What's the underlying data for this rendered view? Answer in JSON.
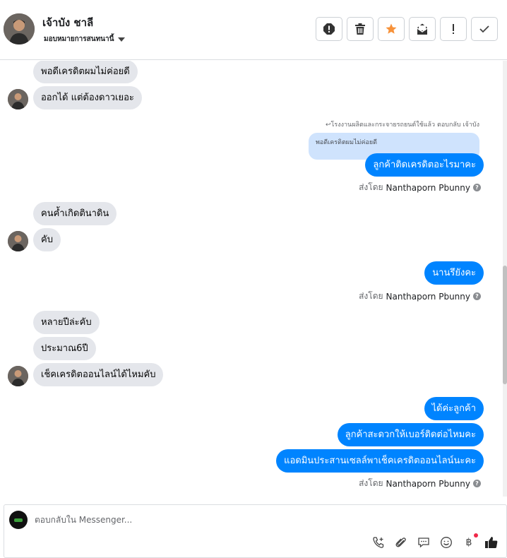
{
  "header": {
    "name": "เจ้าบัง ชาลี",
    "assign_label": "มอบหมายการสนทนานี้"
  },
  "thread": {
    "m1": "พอดีเครดิตผมไม่ค่อยดี",
    "m2": "ออกได้ แต่ต้องดาวเยอะ",
    "reply_meta": "↩โรงงานผลิตและกระจายรถยนต์ใช้แล้ว ตอบกลับ เจ้าบัง",
    "quote_text": "พอดีเครดิตผมไม่ค่อยดี",
    "m3": "ลูกค้าติดเครดิตอะไรมาคะ",
    "sent_prefix": "ส่งโดย",
    "sent_by": "Nanthaporn Pbunny",
    "m4": "คนค้ำเกิดตินาดิน",
    "m5": "คับ",
    "m6": "นานรึยังคะ",
    "m7": "หลายปีล่ะคับ",
    "m8": "ประมาณ6ปี",
    "m9": "เช็คเครดิตออนไลน์ได้ไหมคับ",
    "m10": "ได้ค่ะลูกค้า",
    "m11": "ลูกค้าสะดวกให้เบอร์ติดต่อไหมคะ",
    "m12": "แอดมินประสานเซลล์พาเช็คเครดิตออนไลน์นะคะ"
  },
  "composer": {
    "placeholder": "ตอบกลับใน Messenger...",
    "baht": "฿"
  },
  "colors": {
    "outgoing": "#0084ff",
    "incoming": "#e4e6eb",
    "quote": "#cfe3fd",
    "star": "#f7923a"
  },
  "icons": [
    "alert-icon",
    "trash-icon",
    "star-icon",
    "mail-icon",
    "exclamation-icon",
    "check-icon",
    "phone-icon",
    "paperclip-icon",
    "chat-icon",
    "emoji-icon",
    "baht-icon",
    "thumbs-up-icon"
  ]
}
